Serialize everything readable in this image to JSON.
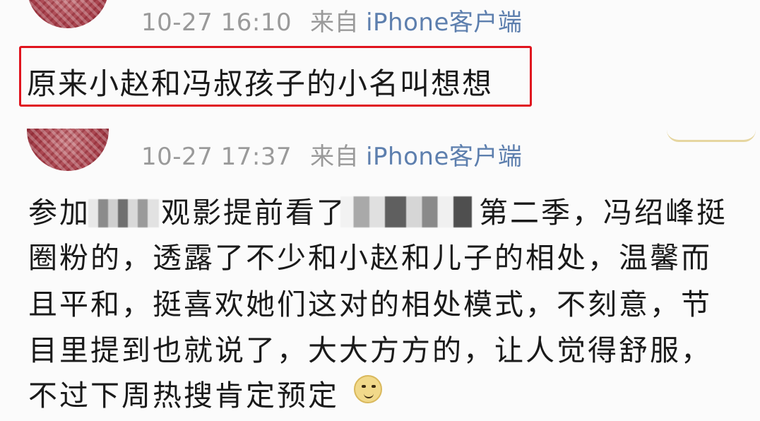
{
  "posts": [
    {
      "time": "10-27 16:10",
      "from_label": "来自",
      "client": "iPhone客户端",
      "text": "原来小赵和冯叔孩子的小名叫想想",
      "highlighted": true,
      "highlight_color": "#e0141e"
    },
    {
      "time": "10-27 17:37",
      "from_label": "来自",
      "client": "iPhone客户端",
      "lines": [
        {
          "before": "参加",
          "after": "观影提前看了"
        },
        "圈粉的，透露了不少和小赵和儿子的相处，温馨而",
        "且平和，挺喜欢她们这对的相处模式，不刻意，节",
        "目里提到也就说了，大大方方的，让人觉得舒服，",
        "不过下周热搜肯定预定"
      ],
      "line1_tail": "第二季，冯绍峰挺",
      "emoji": "doge-icon"
    }
  ],
  "colors": {
    "meta_text": "#9a9a9a",
    "client_link": "#5d7fae",
    "body_text": "#1a1a1a"
  }
}
